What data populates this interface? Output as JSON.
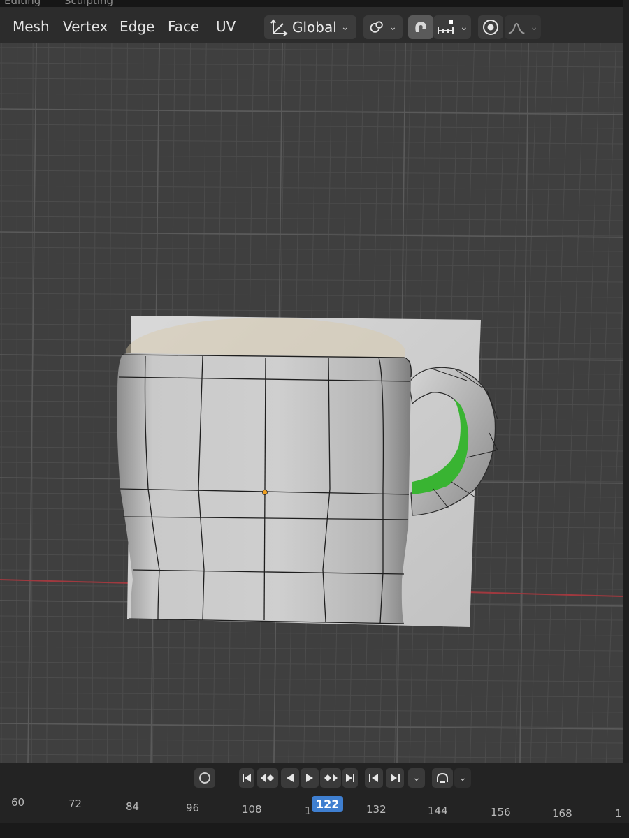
{
  "menu": {
    "items": [
      "Mesh",
      "Vertex",
      "Edge",
      "Face",
      "UV"
    ]
  },
  "workspace_tabs": [
    "Editing",
    "Sculpting"
  ],
  "transform": {
    "orientation": "Global"
  },
  "icons": {
    "orientation": "transform-orientation-icon",
    "pivot": "pivot-point-icon",
    "snap": "snap-magnet-icon",
    "snap_target": "snap-increment-icon",
    "proportional": "proportional-editing-icon",
    "falloff": "falloff-curve-icon",
    "record": "record-icon",
    "jump_start": "jump-start-icon",
    "prev_key": "previous-keyframe-icon",
    "play_reverse": "play-reverse-icon",
    "play": "play-icon",
    "next_key": "next-keyframe-icon",
    "jump_end": "jump-end-icon",
    "prev_frame": "previous-frame-icon",
    "next_frame": "next-frame-icon",
    "keying": "keying-icon"
  },
  "timeline": {
    "frame_numbers": [
      "60",
      "72",
      "84",
      "96",
      "108",
      "1",
      "132",
      "144",
      "156",
      "168",
      "1"
    ],
    "current_frame": "122"
  },
  "colors": {
    "viewport_bg": "#3f3f3f",
    "grid_line": "#4c4c4c",
    "x_axis": "#a0393f",
    "handle_inner": "#39b432",
    "current_frame": "#3f7fd0",
    "origin": "#f0a020"
  }
}
